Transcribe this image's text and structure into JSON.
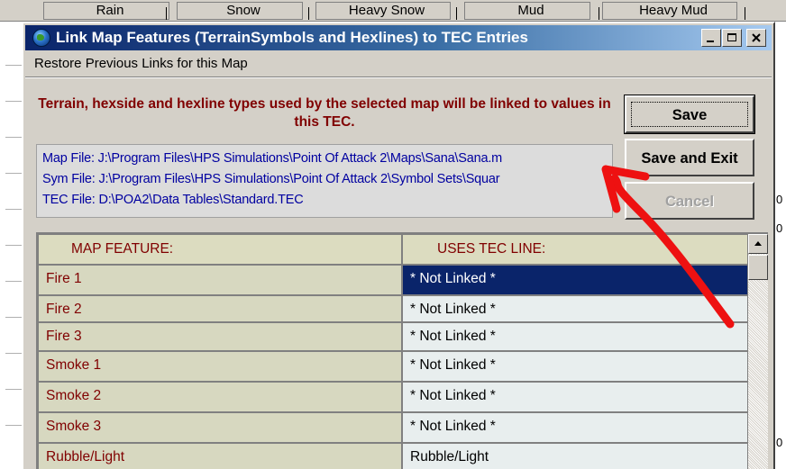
{
  "background_app": {
    "column_headers": [
      "Rain",
      "Snow",
      "Heavy Snow",
      "Mud",
      "Heavy Mud"
    ],
    "right_edge_chars": [
      "0",
      "0",
      "0"
    ]
  },
  "dialog": {
    "title": "Link Map Features (TerrainSymbols and Hexlines) to TEC Entries",
    "icon": "globe-icon",
    "menu": {
      "restore_links": "Restore Previous Links for this Map"
    },
    "info_message": "Terrain, hexside and hexline types used by the selected map will be linked to values in this TEC.",
    "files": {
      "map_file": "Map File: J:\\Program Files\\HPS Simulations\\Point Of Attack 2\\Maps\\Sana\\Sana.m",
      "sym_file": "Sym File: J:\\Program Files\\HPS Simulations\\Point Of Attack 2\\Symbol Sets\\Squar",
      "tec_file": "TEC File: D:\\POA2\\Data Tables\\Standard.TEC"
    },
    "buttons": {
      "save": "Save",
      "save_and_exit": "Save and Exit",
      "cancel": "Cancel"
    },
    "grid": {
      "headers": {
        "map_feature": "MAP FEATURE:",
        "uses_tec_line": "USES TEC LINE:"
      },
      "rows": [
        {
          "feature": "Fire 1",
          "tec": "* Not Linked *"
        },
        {
          "feature": "Fire 2",
          "tec": "* Not Linked *"
        },
        {
          "feature": "Fire 3",
          "tec": "* Not Linked *"
        },
        {
          "feature": "Smoke 1",
          "tec": "* Not Linked *"
        },
        {
          "feature": "Smoke 2",
          "tec": "* Not Linked *"
        },
        {
          "feature": "Smoke 3",
          "tec": "* Not Linked *"
        },
        {
          "feature": "Rubble/Light",
          "tec": "Rubble/Light"
        }
      ],
      "selected_row": 0
    }
  },
  "colors": {
    "dialog_face": "#d4d0c8",
    "title_blue": "#0a246a",
    "message_red": "#800000",
    "path_blue": "#0000a0",
    "selection": "#0a246a",
    "annotation_arrow": "#ee1111"
  }
}
